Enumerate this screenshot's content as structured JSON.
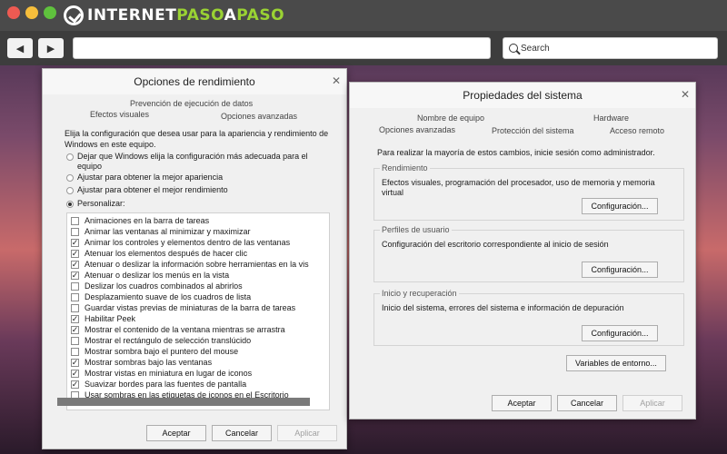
{
  "browser": {
    "logo": {
      "part1": "INTERNET",
      "part2": "PASO",
      "part3": "A",
      "part4": "PASO"
    },
    "nav": {
      "back_icon": "◀",
      "forward_icon": "▶"
    },
    "url": "",
    "search_placeholder": "Search"
  },
  "performance_dialog": {
    "title": "Opciones de rendimiento",
    "close": "✕",
    "tabs": {
      "dep": "Prevención de ejecución de datos",
      "visual": "Efectos visuales",
      "advanced": "Opciones avanzadas"
    },
    "intro": "Elija la configuración que desea usar para la apariencia y rendimiento de Windows en este equipo.",
    "radios": [
      {
        "label": "Dejar que Windows elija la configuración más adecuada para el equipo",
        "selected": false
      },
      {
        "label": "Ajustar para obtener la mejor apariencia",
        "selected": false
      },
      {
        "label": "Ajustar para obtener el mejor rendimiento",
        "selected": false
      },
      {
        "label": "Personalizar:",
        "selected": true
      }
    ],
    "effects": [
      {
        "label": "Animaciones en la barra de tareas",
        "checked": false
      },
      {
        "label": "Animar las ventanas al minimizar y maximizar",
        "checked": false
      },
      {
        "label": "Animar los controles y elementos dentro de las ventanas",
        "checked": true
      },
      {
        "label": "Atenuar los elementos después de hacer clic",
        "checked": true
      },
      {
        "label": "Atenuar o deslizar la información sobre herramientas en la vis",
        "checked": true
      },
      {
        "label": "Atenuar o deslizar los menús en la vista",
        "checked": true
      },
      {
        "label": "Deslizar los cuadros combinados al abrirlos",
        "checked": false
      },
      {
        "label": "Desplazamiento suave de los cuadros de lista",
        "checked": false
      },
      {
        "label": "Guardar vistas previas de miniaturas de la barra de tareas",
        "checked": false
      },
      {
        "label": "Habilitar Peek",
        "checked": true
      },
      {
        "label": "Mostrar el contenido de la ventana mientras se arrastra",
        "checked": true
      },
      {
        "label": "Mostrar el rectángulo de selección translúcido",
        "checked": false
      },
      {
        "label": "Mostrar sombra bajo el puntero del mouse",
        "checked": false
      },
      {
        "label": "Mostrar sombras bajo las ventanas",
        "checked": true
      },
      {
        "label": "Mostrar vistas en miniatura en lugar de iconos",
        "checked": true
      },
      {
        "label": "Suavizar bordes para las fuentes de pantalla",
        "checked": true
      },
      {
        "label": "Usar sombras en las etiquetas de iconos en el Escritorio",
        "checked": false
      }
    ],
    "buttons": {
      "accept": "Aceptar",
      "cancel": "Cancelar",
      "apply": "Aplicar"
    }
  },
  "system_dialog": {
    "title": "Propiedades del sistema",
    "close": "✕",
    "tabs": {
      "computer_name": "Nombre de equipo",
      "hardware": "Hardware",
      "advanced": "Opciones avanzadas",
      "protection": "Protección del sistema",
      "remote": "Acceso remoto"
    },
    "admin_note": "Para realizar la mayoría de estos cambios, inicie sesión como administrador.",
    "groups": [
      {
        "title": "Rendimiento",
        "text": "Efectos visuales, programación del procesador, uso de memoria y memoria virtual",
        "button": "Configuración..."
      },
      {
        "title": "Perfiles de usuario",
        "text": "Configuración del escritorio correspondiente al inicio de sesión",
        "button": "Configuración..."
      },
      {
        "title": "Inicio y recuperación",
        "text": "Inicio del sistema, errores del sistema e información de depuración",
        "button": "Configuración..."
      }
    ],
    "env_button": "Variables de entorno...",
    "buttons": {
      "accept": "Aceptar",
      "cancel": "Cancelar",
      "apply": "Aplicar"
    }
  }
}
